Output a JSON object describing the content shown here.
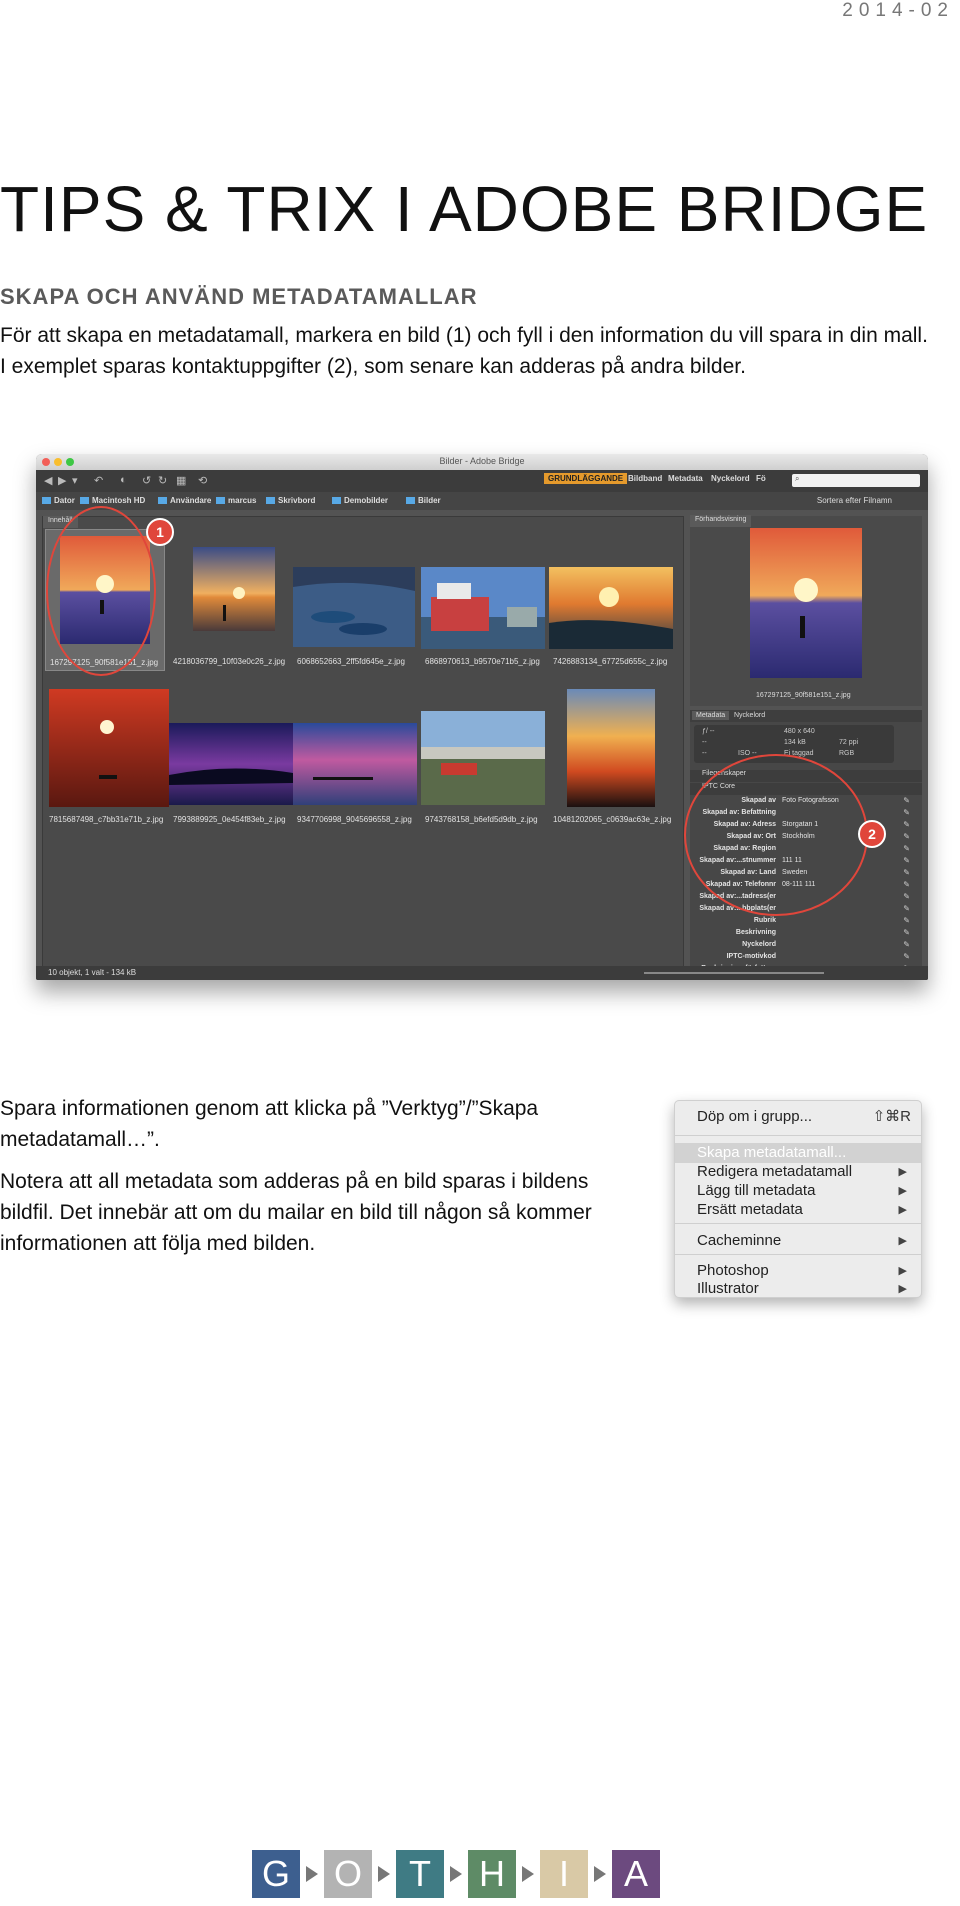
{
  "header": {
    "date": "2014-02"
  },
  "page": {
    "title": "TIPS & TRIX I ADOBE BRIDGE",
    "subtitle": "SKAPA OCH ANVÄND METADATAMALLAR",
    "intro_line1": "För att skapa en metadatamall, markera en bild (1) och fyll i den information du vill spara in din mall.",
    "intro_line2": "I exemplet sparas kontaktuppgifter (2), som senare kan adderas på andra bilder."
  },
  "bridge": {
    "window_title": "Bilder - Adobe Bridge",
    "workspaces": [
      "GRUNDLÄGGANDE",
      "Bildband",
      "Metadata",
      "Nyckelord",
      "Fö"
    ],
    "breadcrumbs": [
      "Dator",
      "Macintosh HD",
      "Användare",
      "marcus",
      "Skrivbord",
      "Demobilder",
      "Bilder"
    ],
    "sort_label": "Sortera efter Filnamn",
    "content_tab": "Innehåll",
    "preview_tab": "Förhandsvisning",
    "thumbnails": [
      {
        "name": "167297125_90f581e151_z.jpg"
      },
      {
        "name": "4218036799_10f03e0c26_z.jpg"
      },
      {
        "name": "6068652663_2ff5fd645e_z.jpg"
      },
      {
        "name": "6868970613_b9570e71b5_z.jpg"
      },
      {
        "name": "7426883134_67725d655c_z.jpg"
      },
      {
        "name": "7815687498_c7bb31e71b_z.jpg"
      },
      {
        "name": "7993889925_0e454f83eb_z.jpg"
      },
      {
        "name": "9347706998_9045696558_z.jpg"
      },
      {
        "name": "9743768158_b6efd5d9db_z.jpg"
      },
      {
        "name": "10481202065_c0639ac63e_z.jpg"
      }
    ],
    "preview_filename": "167297125_90f581e151_z.jpg",
    "meta_tabs": [
      "Metadata",
      "Nyckelord"
    ],
    "camera": {
      "aperture": "ƒ/ --",
      "a2": "--",
      "a3": "--",
      "iso": "ISO --",
      "dims": "480 x 640",
      "size": "134 kB",
      "ppi": "72 ppi",
      "tag": "Ej taggad",
      "mode": "RGB"
    },
    "sections": {
      "file": "Filegenskaper",
      "iptc": "IPTC Core"
    },
    "fields": [
      {
        "key": "Skapad av",
        "value": "Foto Fotografsson"
      },
      {
        "key": "Skapad av: Befattning",
        "value": ""
      },
      {
        "key": "Skapad av: Adress",
        "value": "Storgatan 1"
      },
      {
        "key": "Skapad av: Ort",
        "value": "Stockholm"
      },
      {
        "key": "Skapad av: Region",
        "value": ""
      },
      {
        "key": "Skapad av:...stnummer",
        "value": "111 11"
      },
      {
        "key": "Skapad av: Land",
        "value": "Sweden"
      },
      {
        "key": "Skapad av: Telefonnr",
        "value": "08-111 111"
      },
      {
        "key": "Skapad av:...tadress(er",
        "value": ""
      },
      {
        "key": "Skapad av:...bbplats(er",
        "value": ""
      },
      {
        "key": "Rubrik",
        "value": ""
      },
      {
        "key": "Beskrivning",
        "value": ""
      },
      {
        "key": "Nyckelord",
        "value": ""
      },
      {
        "key": "IPTC-motivkod",
        "value": ""
      },
      {
        "key": "Beskrivningsförfattare",
        "value": ""
      }
    ],
    "status": "10 objekt, 1 valt - 134 kB",
    "callouts": [
      "1",
      "2"
    ]
  },
  "body": {
    "para1_line1": "Spara informationen genom att klicka på ”Verktyg”/”Skapa",
    "para1_line2": "metadatamall…”.",
    "para2_line1": "Notera att all metadata som adderas på en bild sparas i bildens",
    "para2_line2": "bildfil. Det innebär att om du mailar en bild till någon så kommer",
    "para2_line3": "informationen att följa med bilden."
  },
  "menu": {
    "items": [
      {
        "label": "Döp om i grupp...",
        "shortcut": "⇧⌘R"
      },
      {
        "label": "Skapa metadatamall..."
      },
      {
        "label": "Redigera metadatamall"
      },
      {
        "label": "Lägg till metadata"
      },
      {
        "label": "Ersätt metadata"
      },
      {
        "label": "Cacheminne"
      },
      {
        "label": "Photoshop"
      },
      {
        "label": "Illustrator"
      }
    ]
  },
  "logo": {
    "letters": [
      "G",
      "O",
      "T",
      "H",
      "I",
      "A"
    ],
    "colors": [
      "#3d5f8f",
      "#b3b3b3",
      "#3f7b84",
      "#5e8b66",
      "#d9c9a6",
      "#6c4a7f"
    ]
  }
}
